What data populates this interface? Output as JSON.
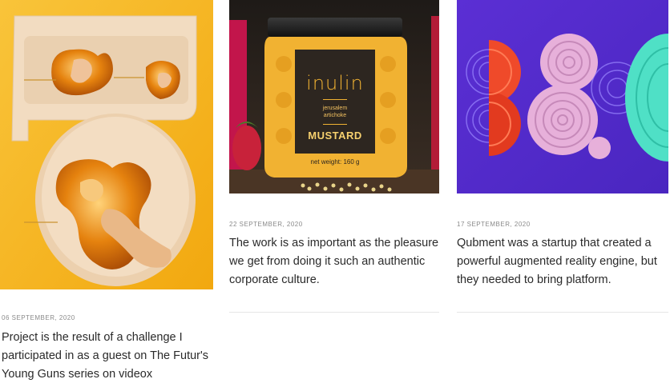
{
  "posts": [
    {
      "image_alt": "yellow abstract sculpture with honey-like drips",
      "date": "06 SEPTEMBER, 2020",
      "excerpt": "Project is the result of a challenge I participated in as a guest on The Futur's Young Guns series on videox",
      "colors": {
        "bg": "#f6b61a",
        "accent": "#e7a14a"
      }
    },
    {
      "image_alt": "jar of mustard with yellow patterned label",
      "date": "22 SEPTEMBER, 2020",
      "excerpt": "The work is as important as the pleasure we get from doing it such an authentic corporate culture.",
      "label": {
        "brand": "inulin",
        "subtitle": "jerusalem artichoke",
        "product": "MUSTARD",
        "weight": "net weight: 160 g"
      },
      "colors": {
        "bg": "#3a2c22",
        "accent": "#f1b232"
      }
    },
    {
      "image_alt": "3D digits on purple background",
      "date": "17 SEPTEMBER, 2020",
      "excerpt": "Qubment was a startup that created a powerful augmented reality engine, but they needed to bring platform.",
      "colors": {
        "bg": "#5a2fd1",
        "accent": "#e9b1d8"
      }
    }
  ]
}
